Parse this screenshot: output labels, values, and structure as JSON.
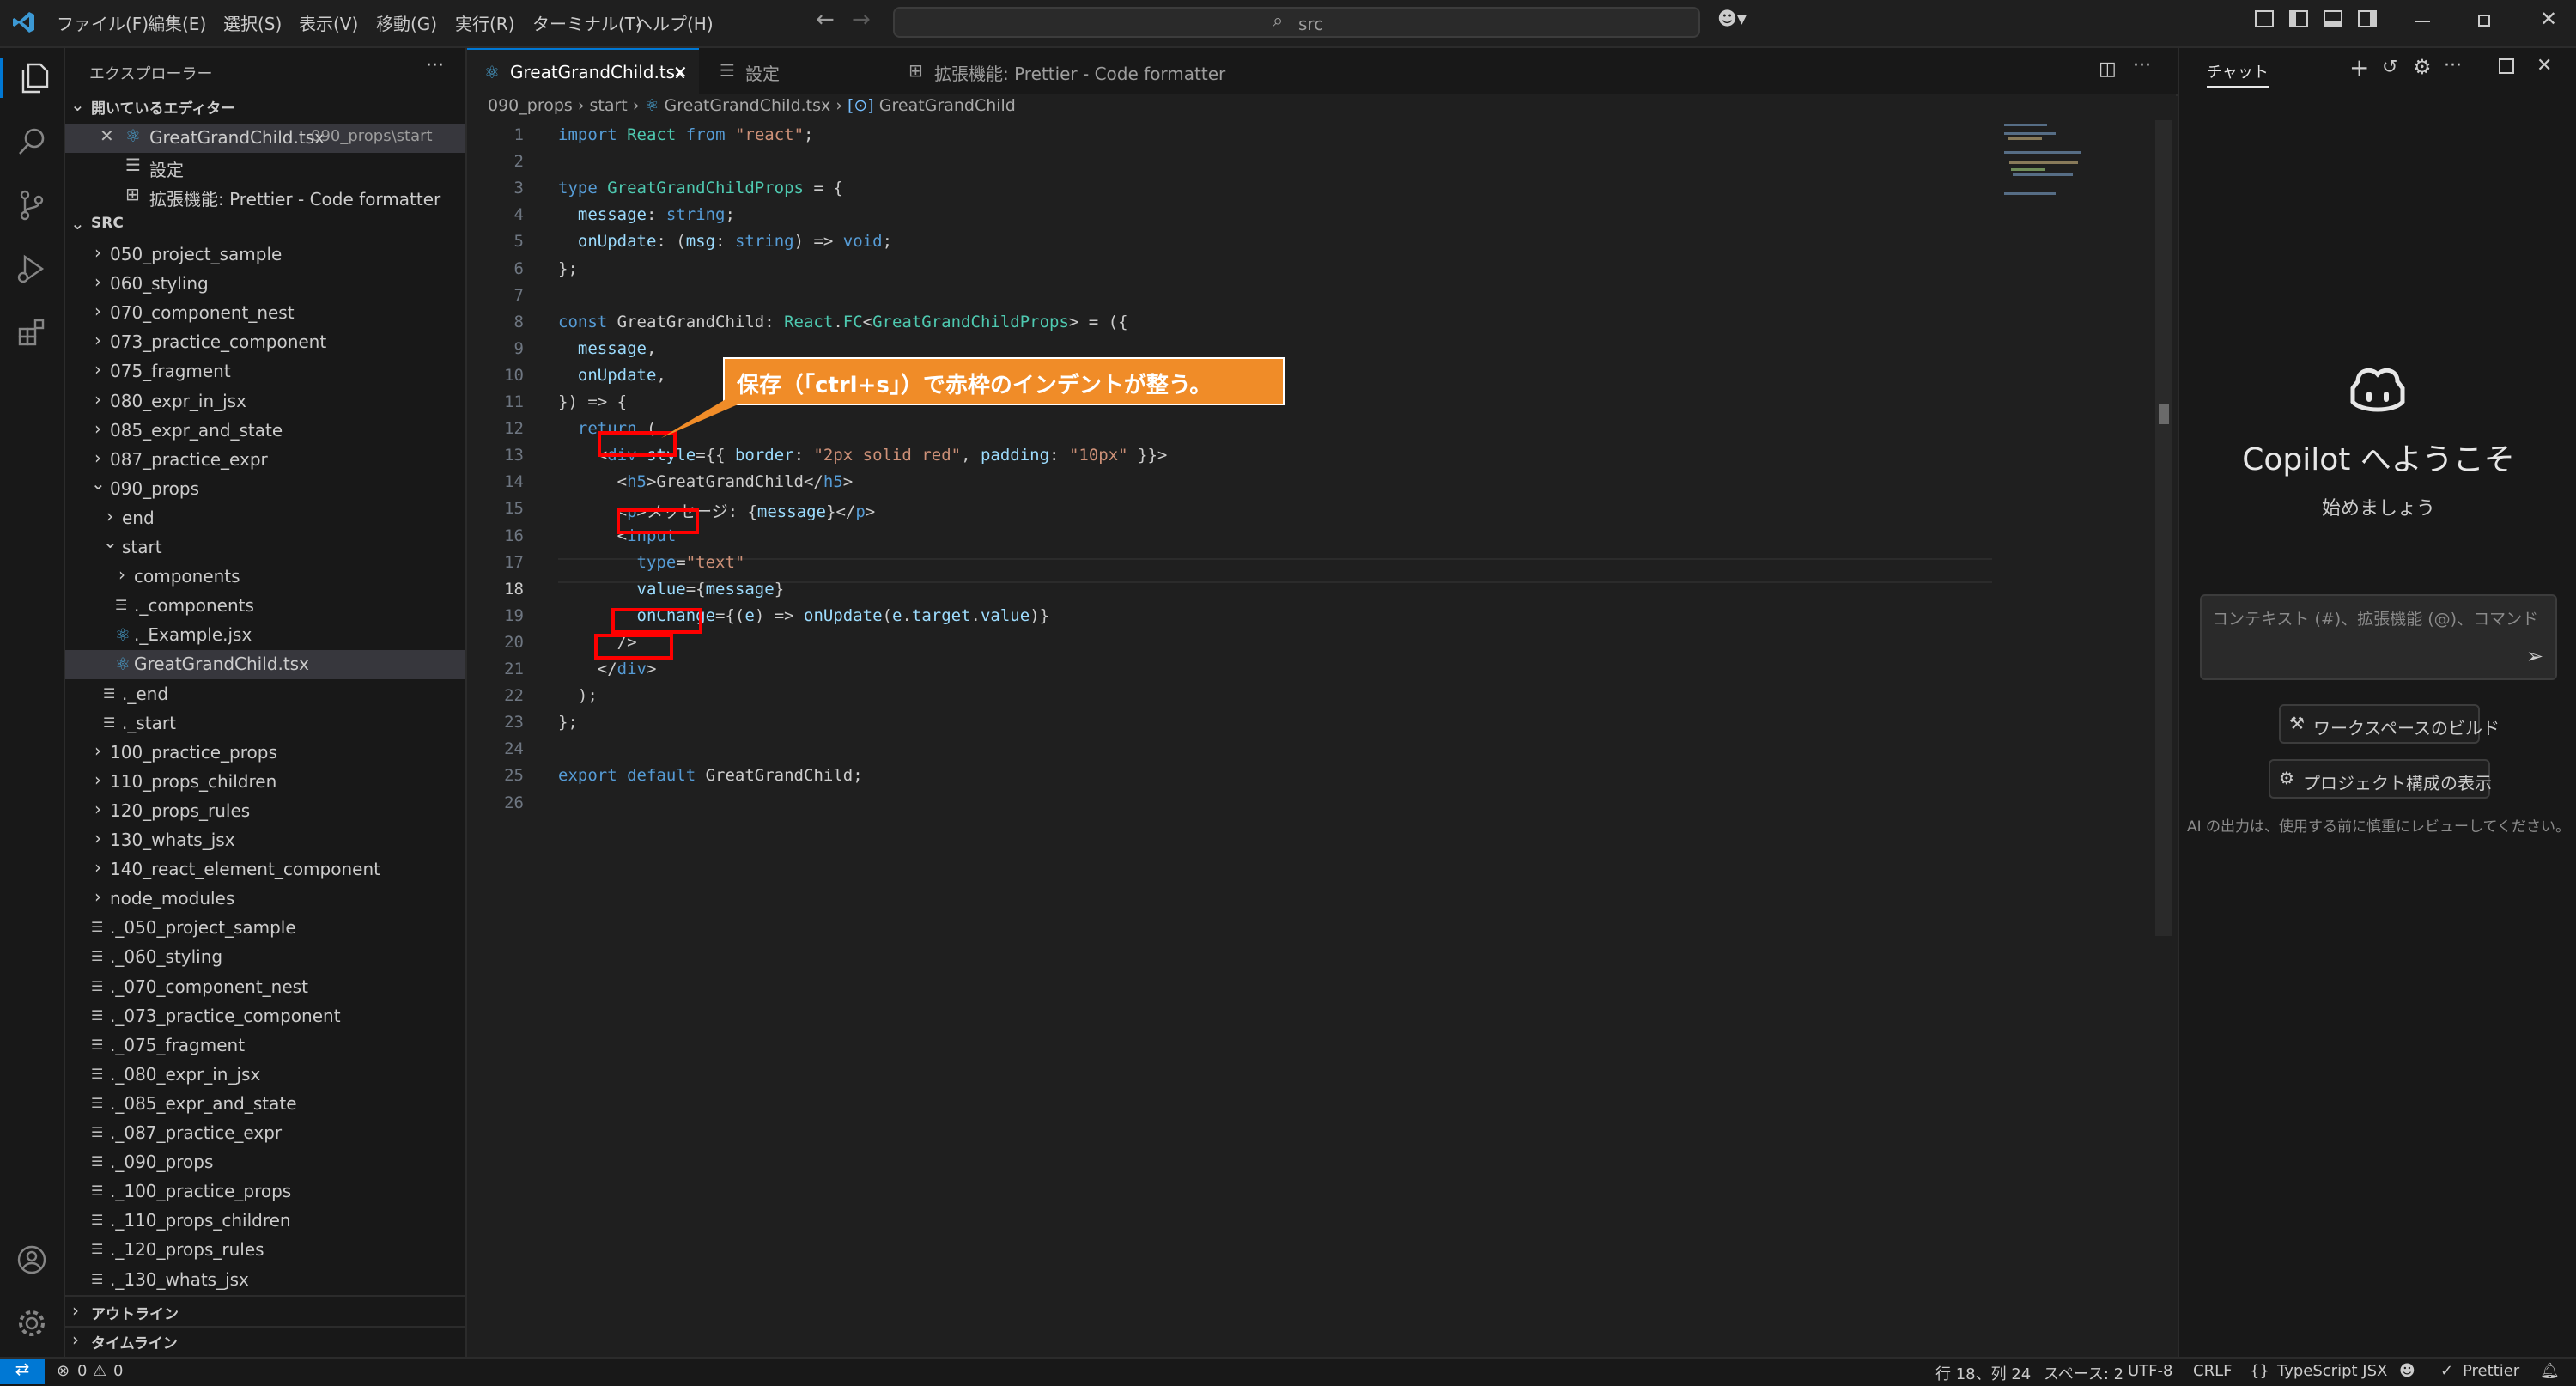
{
  "menu": [
    "ファイル(F)",
    "編集(E)",
    "選択(S)",
    "表示(V)",
    "移動(G)",
    "実行(R)",
    "ターミナル(T)",
    "ヘルプ(H)"
  ],
  "search": {
    "text": "src"
  },
  "explorer": {
    "title": "エクスプローラー",
    "open_editors_title": "開いているエディター",
    "open_editors": [
      {
        "name": "GreatGrandChild.tsx",
        "path": "090_props\\start"
      },
      {
        "name": "設定"
      },
      {
        "name": "拡張機能: Prettier - Code formatter"
      }
    ],
    "src_title": "SRC",
    "tree": [
      "050_project_sample",
      "060_styling",
      "070_component_nest",
      "073_practice_component",
      "075_fragment",
      "080_expr_in_jsx",
      "085_expr_and_state",
      "087_practice_expr",
      "090_props",
      "end",
      "start",
      "components",
      "._components",
      "._Example.jsx",
      "GreatGrandChild.tsx",
      "._end",
      "._start",
      "100_practice_props",
      "110_props_children",
      "120_props_rules",
      "130_whats_jsx",
      "140_react_element_component",
      "node_modules",
      "._050_project_sample",
      "._060_styling",
      "._070_component_nest",
      "._073_practice_component",
      "._075_fragment",
      "._080_expr_in_jsx",
      "._085_expr_and_state",
      "._087_practice_expr",
      "._090_props",
      "._100_practice_props",
      "._110_props_children",
      "._120_props_rules",
      "._130_whats_jsx"
    ],
    "outline": "アウトライン",
    "timeline": "タイムライン"
  },
  "tabs": [
    {
      "label": "GreatGrandChild.tsx"
    },
    {
      "label": "設定"
    },
    {
      "label": "拡張機能: Prettier - Code formatter"
    }
  ],
  "breadcrumb": [
    "090_props",
    "start",
    "GreatGrandChild.tsx",
    "GreatGrandChild"
  ],
  "code_lines": [
    "import React from \"react\";",
    "",
    "type GreatGrandChildProps = {",
    "  message: string;",
    "  onUpdate: (msg: string) => void;",
    "};",
    "",
    "const GreatGrandChild: React.FC<GreatGrandChildProps> = ({",
    "  message,",
    "  onUpdate,",
    "}) => {",
    "  return (",
    "    <div style={{ border: \"2px solid red\", padding: \"10px\" }}>",
    "      <h5>GreatGrandChild</h5>",
    "      <p>メッセージ: {message}</p>",
    "      <input",
    "        type=\"text\"",
    "        value={message}",
    "        onChange={(e) => onUpdate(e.target.value)}",
    "      />",
    "    </div>",
    "  );",
    "};",
    "",
    "export default GreatGrandChild;",
    ""
  ],
  "callout": "保存（「ctrl+s」）で赤枠のインデントが整う。",
  "chat": {
    "title": "チャット",
    "welcome": "Copilot へようこそ",
    "subtitle": "始めましょう",
    "input_placeholder": "コンテキスト (#)、拡張機能 (@)、コマンド",
    "btn_workspace": "ワークスペースのビルド",
    "btn_project": "プロジェクト構成の表示",
    "disclaimer": "AI の出力は、使用する前に慎重にレビューしてください。"
  },
  "status": {
    "errors": "0",
    "warnings": "0",
    "position": "行 18、列 24",
    "spaces": "スペース: 2",
    "encoding": "UTF-8",
    "eol": "CRLF",
    "language": "TypeScript JSX",
    "prettier": "Prettier"
  },
  "colors": {
    "accent": "#0078d4",
    "callout": "#f08c28",
    "highlight": "#ff0000"
  }
}
